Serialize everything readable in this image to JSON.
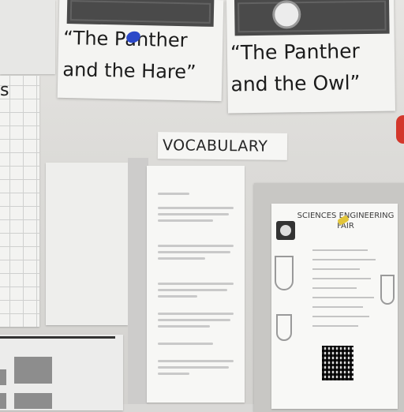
{
  "cards": {
    "left": {
      "line1": "“The Panther",
      "line2": "and the Hare”"
    },
    "right": {
      "line1": "“The Panther",
      "line2": "and the Owl”"
    }
  },
  "vocabulary_label": "VOCABULARY",
  "left_paper_letter": "s",
  "flyer": {
    "title_line1": "SCIENCES ENGINEERING",
    "title_line2": "FAIR"
  },
  "colors": {
    "pin_blue": "#2b48c8",
    "pin_red": "#d3372b",
    "pin_yellow": "#e2c53a",
    "wall": "#dcdbd8"
  }
}
